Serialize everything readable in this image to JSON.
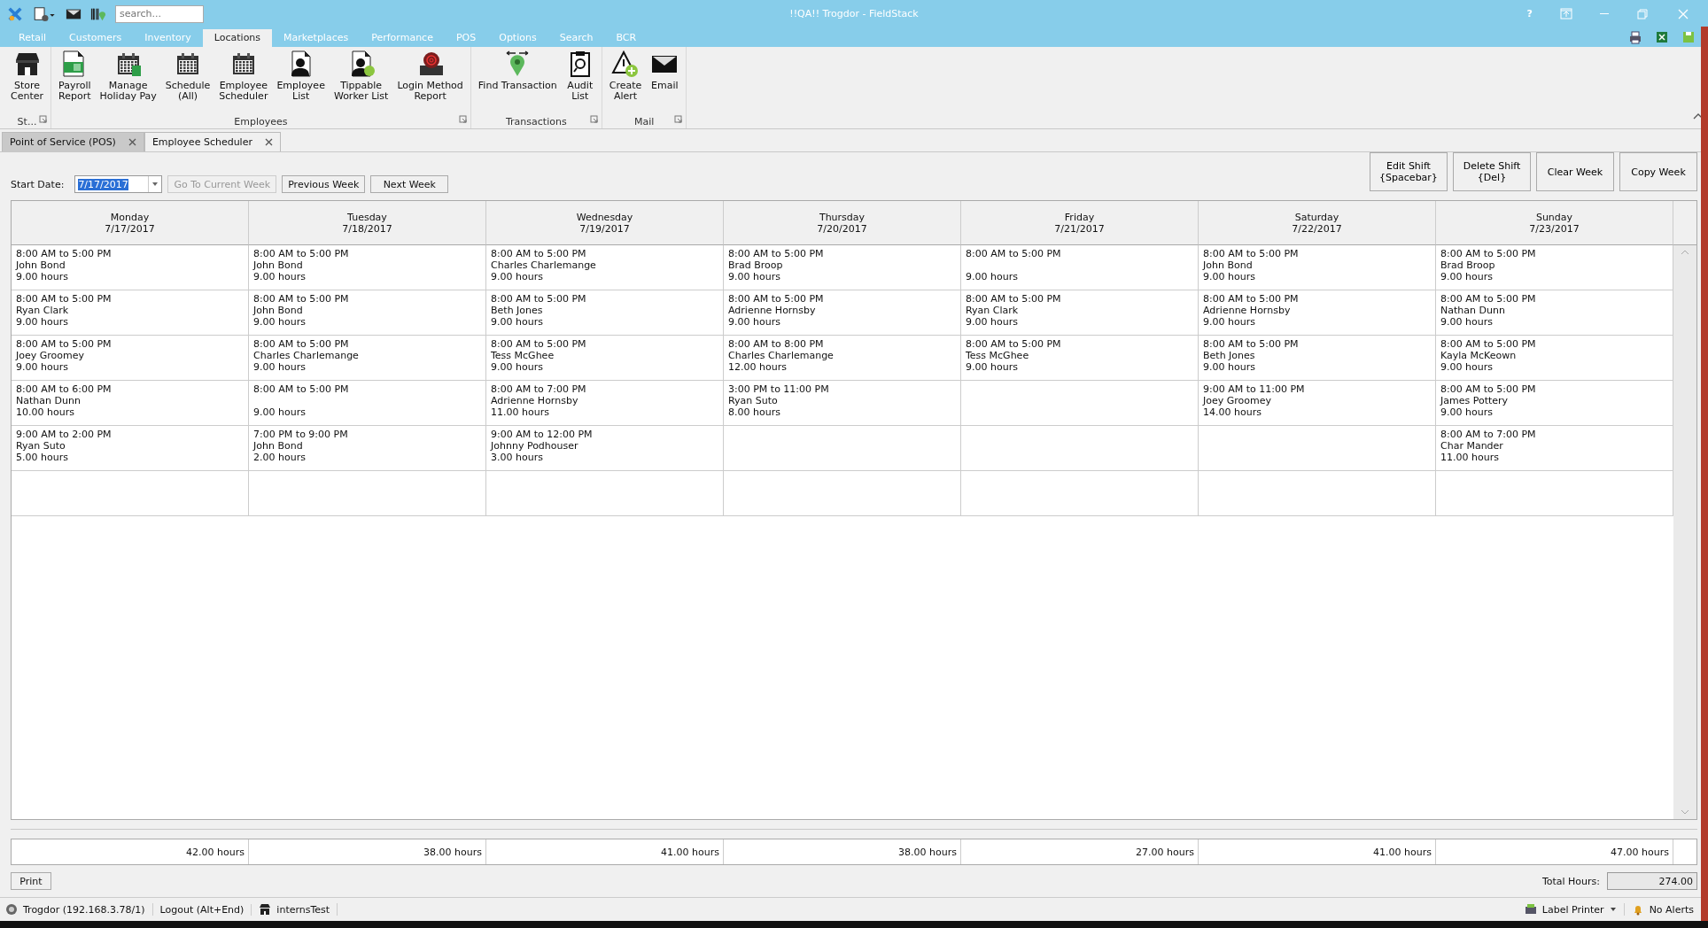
{
  "window": {
    "title": "!!QA!! Trogdor - FieldStack",
    "help": "?",
    "search": {
      "placeholder": "search..."
    }
  },
  "ribbon_tabs": [
    {
      "label": "Retail",
      "selected": false
    },
    {
      "label": "Customers",
      "selected": false
    },
    {
      "label": "Inventory",
      "selected": false
    },
    {
      "label": "Locations",
      "selected": true
    },
    {
      "label": "Marketplaces",
      "selected": false
    },
    {
      "label": "Performance",
      "selected": false
    },
    {
      "label": "POS",
      "selected": false
    },
    {
      "label": "Options",
      "selected": false
    },
    {
      "label": "Search",
      "selected": false
    },
    {
      "label": "BCR",
      "selected": false
    }
  ],
  "ribbon_groups": [
    {
      "label": "St...",
      "items": [
        "Store\nCenter"
      ]
    },
    {
      "label": "Employees",
      "items": [
        "Payroll\nReport",
        "Manage\nHoliday Pay",
        "Schedule\n(All)",
        "Employee\nScheduler",
        "Employee\nList",
        "Tippable\nWorker List",
        "Login Method\nReport"
      ]
    },
    {
      "label": "Transactions",
      "items": [
        "Find Transaction",
        "Audit\nList"
      ]
    },
    {
      "label": "Mail",
      "items": [
        "Create\nAlert",
        "Email"
      ]
    }
  ],
  "document_tabs": [
    {
      "label": "Point of Service (POS)",
      "selected": false
    },
    {
      "label": "Employee Scheduler",
      "selected": true
    }
  ],
  "toolbar": {
    "start_date_label": "Start Date:",
    "start_date": "7/17/2017",
    "start_date_selected": true,
    "buttons": [
      {
        "label": "Go To Current Week",
        "disabled": true
      },
      {
        "label": "Previous Week",
        "disabled": false
      },
      {
        "label": "Next Week",
        "disabled": false
      }
    ],
    "actions": [
      "Edit Shift\n{Spacebar}",
      "Delete Shift\n{Del}",
      "Clear Week",
      "Copy Week"
    ]
  },
  "days": [
    {
      "day": "Monday",
      "date": "7/17/2017",
      "total": "42.00 hours",
      "shifts": [
        {
          "time": "8:00 AM to 5:00 PM",
          "employee": "John Bond",
          "hours": "9.00 hours"
        },
        {
          "time": "8:00 AM to 5:00 PM",
          "employee": "Ryan Clark",
          "hours": "9.00 hours"
        },
        {
          "time": "8:00 AM to 5:00 PM",
          "employee": "Joey Groomey",
          "hours": "9.00 hours"
        },
        {
          "time": "8:00 AM to 6:00 PM",
          "employee": "Nathan  Dunn",
          "hours": "10.00 hours"
        },
        {
          "time": "9:00 AM to 2:00 PM",
          "employee": "Ryan Suto",
          "hours": "5.00 hours"
        }
      ]
    },
    {
      "day": "Tuesday",
      "date": "7/18/2017",
      "total": "38.00 hours",
      "shifts": [
        {
          "time": "8:00 AM to 5:00 PM",
          "employee": "John Bond",
          "hours": "9.00 hours"
        },
        {
          "time": "8:00 AM to 5:00 PM",
          "employee": "John Bond",
          "hours": "9.00 hours"
        },
        {
          "time": "8:00 AM to 5:00 PM",
          "employee": "Charles Charlemange",
          "hours": "9.00 hours"
        },
        {
          "time": "8:00 AM to 5:00 PM",
          "hours": "9.00 hours"
        },
        {
          "time": "7:00 PM to 9:00 PM",
          "employee": "John Bond",
          "hours": "2.00 hours"
        }
      ]
    },
    {
      "day": "Wednesday",
      "date": "7/19/2017",
      "total": "41.00 hours",
      "shifts": [
        {
          "time": "8:00 AM to 5:00 PM",
          "employee": "Charles Charlemange",
          "hours": "9.00 hours"
        },
        {
          "time": "8:00 AM to 5:00 PM",
          "employee": "Beth Jones",
          "hours": "9.00 hours"
        },
        {
          "time": "8:00 AM to 5:00 PM",
          "employee": "Tess McGhee",
          "hours": "9.00 hours"
        },
        {
          "time": "8:00 AM to 7:00 PM",
          "employee": "Adrienne  Hornsby",
          "hours": "11.00 hours"
        },
        {
          "time": "9:00 AM to 12:00 PM",
          "employee": "Johnny Podhouser",
          "hours": "3.00 hours"
        }
      ]
    },
    {
      "day": "Thursday",
      "date": "7/20/2017",
      "total": "38.00 hours",
      "shifts": [
        {
          "time": "8:00 AM to 5:00 PM",
          "employee": "Brad Broop",
          "hours": "9.00 hours"
        },
        {
          "time": "8:00 AM to 5:00 PM",
          "employee": "Adrienne  Hornsby",
          "hours": "9.00 hours"
        },
        {
          "time": "8:00 AM to 8:00 PM",
          "employee": "Charles Charlemange",
          "hours": "12.00 hours"
        },
        {
          "time": "3:00 PM to 11:00 PM",
          "employee": "Ryan Suto",
          "hours": "8.00 hours"
        }
      ]
    },
    {
      "day": "Friday",
      "date": "7/21/2017",
      "total": "27.00 hours",
      "shifts": [
        {
          "time": "8:00 AM to 5:00 PM",
          "hours": "9.00 hours"
        },
        {
          "time": "8:00 AM to 5:00 PM",
          "employee": "Ryan Clark",
          "hours": "9.00 hours"
        },
        {
          "time": "8:00 AM to 5:00 PM",
          "employee": "Tess McGhee",
          "hours": "9.00 hours"
        }
      ]
    },
    {
      "day": "Saturday",
      "date": "7/22/2017",
      "total": "41.00 hours",
      "shifts": [
        {
          "time": "8:00 AM to 5:00 PM",
          "employee": "John Bond",
          "hours": "9.00 hours"
        },
        {
          "time": "8:00 AM to 5:00 PM",
          "employee": "Adrienne  Hornsby",
          "hours": "9.00 hours"
        },
        {
          "time": "8:00 AM to 5:00 PM",
          "employee": "Beth Jones",
          "hours": "9.00 hours"
        },
        {
          "time": "9:00 AM to 11:00 PM",
          "employee": "Joey Groomey",
          "hours": "14.00 hours"
        }
      ]
    },
    {
      "day": "Sunday",
      "date": "7/23/2017",
      "total": "47.00 hours",
      "shifts": [
        {
          "time": "8:00 AM to 5:00 PM",
          "employee": "Brad Broop",
          "hours": "9.00 hours"
        },
        {
          "time": "8:00 AM to 5:00 PM",
          "employee": "Nathan  Dunn",
          "hours": "9.00 hours"
        },
        {
          "time": "8:00 AM to 5:00 PM",
          "employee": "Kayla McKeown",
          "hours": "9.00 hours"
        },
        {
          "time": "8:00 AM to 5:00 PM",
          "employee": "James Pottery",
          "hours": "9.00 hours"
        },
        {
          "time": "8:00 AM to 7:00 PM",
          "employee": "Char  Mander",
          "hours": "11.00 hours"
        }
      ]
    }
  ],
  "footer": {
    "print": "Print",
    "total_label": "Total Hours:",
    "total": "274.00"
  },
  "status_bar": {
    "server": "Trogdor (192.168.3.78/1)",
    "logout": "Logout (Alt+End)",
    "store": "internsTest",
    "printer": "Label Printer",
    "alerts": "No Alerts"
  }
}
